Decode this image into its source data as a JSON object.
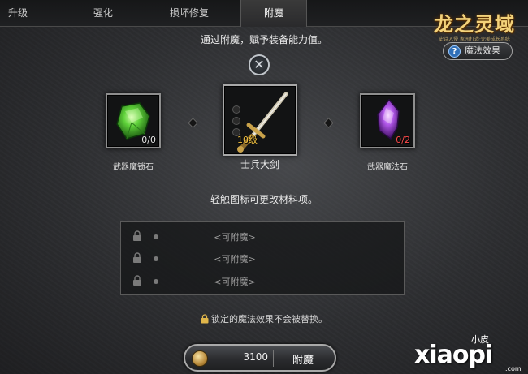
{
  "tabs": [
    {
      "label": "升级"
    },
    {
      "label": "强化"
    },
    {
      "label": "损坏修复"
    },
    {
      "label": "附魔"
    }
  ],
  "active_tab": "附魔",
  "logo": {
    "title": "龙之灵域",
    "subtitle": "史诗入侵  家园打造·完美成长系统"
  },
  "magic_effect_button": {
    "label": "魔法效果",
    "icon": "question-icon"
  },
  "instruction": "通过附魔，赋予装备能力值。",
  "close_icon": "close-icon",
  "slots": {
    "left": {
      "label": "武器魔锁石",
      "count": "0/0",
      "item": "green-crystal"
    },
    "center": {
      "label": "士兵大剑",
      "level": "10级",
      "item": "sword"
    },
    "right": {
      "label": "武器魔法石",
      "count": "0/2",
      "item": "purple-crystal"
    }
  },
  "hint": "轻触图标可更改材料项。",
  "enchant_options": [
    {
      "text": "<可附魔>"
    },
    {
      "text": "<可附魔>"
    },
    {
      "text": "<可附魔>"
    }
  ],
  "lock_note": "锁定的魔法效果不会被替换。",
  "enchant_button": {
    "cost": "3100",
    "label": "附魔"
  },
  "watermark": {
    "top": "小皮",
    "main": "xiaopi",
    "domain": ".com"
  }
}
